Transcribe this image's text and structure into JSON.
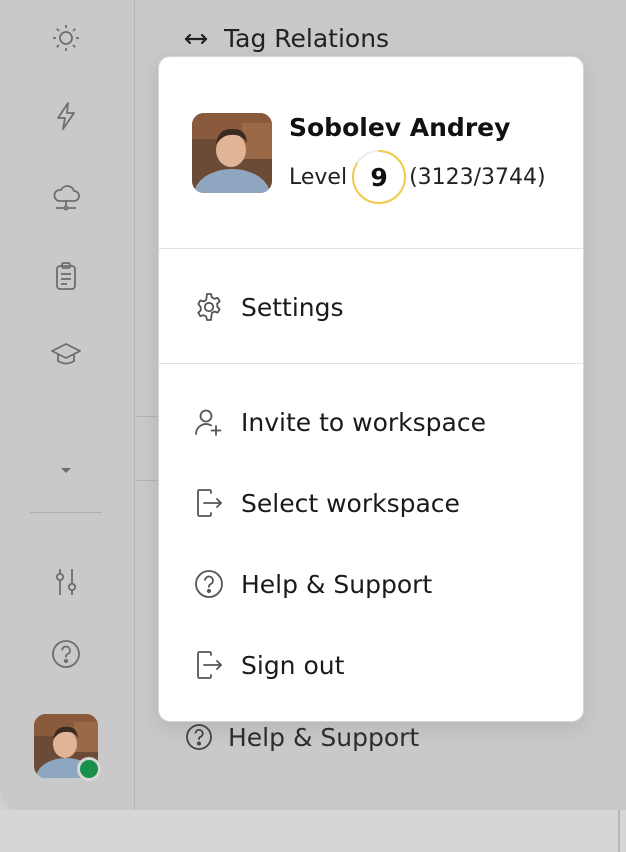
{
  "background": {
    "top_title": "Tag Relations",
    "bottom_help": "Help & Support"
  },
  "user": {
    "name": "Sobolev Andrey",
    "level_label": "Level",
    "level": "9",
    "progress_text": "(3123/3744)",
    "progress_fraction": 0.834,
    "status": "online"
  },
  "menu": {
    "settings": "Settings",
    "invite": "Invite to workspace",
    "select_workspace": "Select workspace",
    "help": "Help & Support",
    "sign_out": "Sign out"
  },
  "icons": {
    "rail": [
      "sun-icon",
      "lightning-icon",
      "cloud-icon",
      "clipboard-icon",
      "graduation-cap-icon",
      "caret-down-icon",
      "sliders-icon",
      "help-icon"
    ]
  },
  "colors": {
    "accent_ring": "#f2c94c",
    "status_online": "#1a8f4b"
  }
}
